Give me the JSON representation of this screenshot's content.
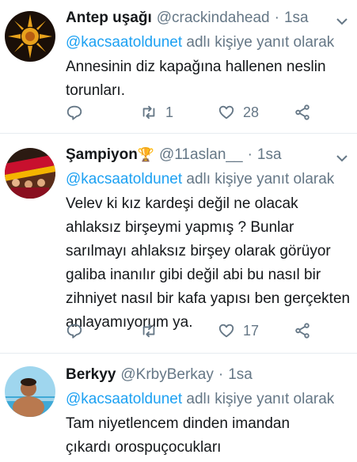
{
  "tweets": [
    {
      "name": "Antep uşağı",
      "badge": "",
      "handle": "@crackindahead",
      "time": "1sa",
      "reply_mention": "@kacsaatoldunet",
      "reply_suffix": " adlı kişiye yanıt olarak",
      "text": "Annesinin diz kapağına hallenen neslin torunları.",
      "retweets": "1",
      "likes": "28"
    },
    {
      "name": "Şampiyon",
      "badge": "🏆",
      "handle": "@11aslan__",
      "time": "1sa",
      "reply_mention": "@kacsaatoldunet",
      "reply_suffix": " adlı kişiye yanıt olarak",
      "text": "Velev ki kız kardeşi değil ne olacak ahlaksız birşeymi yapmış ? Bunlar sarılmayı ahlaksız birşey olarak görüyor galiba inanılır gibi değil abi bu nasıl bir zihniyet nasıl bir kafa yapısı ben gerçekten anlayamıyorum ya.",
      "retweets": "",
      "likes": "17"
    },
    {
      "name": "Berkyy",
      "badge": "",
      "handle": "@KrbyBerkay",
      "time": "1sa",
      "reply_mention": "@kacsaatoldunet",
      "reply_suffix": " adlı kişiye yanıt olarak",
      "text": "Tam niyetlencem dinden imandan çıkardı orospuçocukları",
      "retweets": "",
      "likes": ""
    }
  ],
  "colors": {
    "link": "#1da1f2",
    "muted": "#657786",
    "text": "#14171a"
  }
}
